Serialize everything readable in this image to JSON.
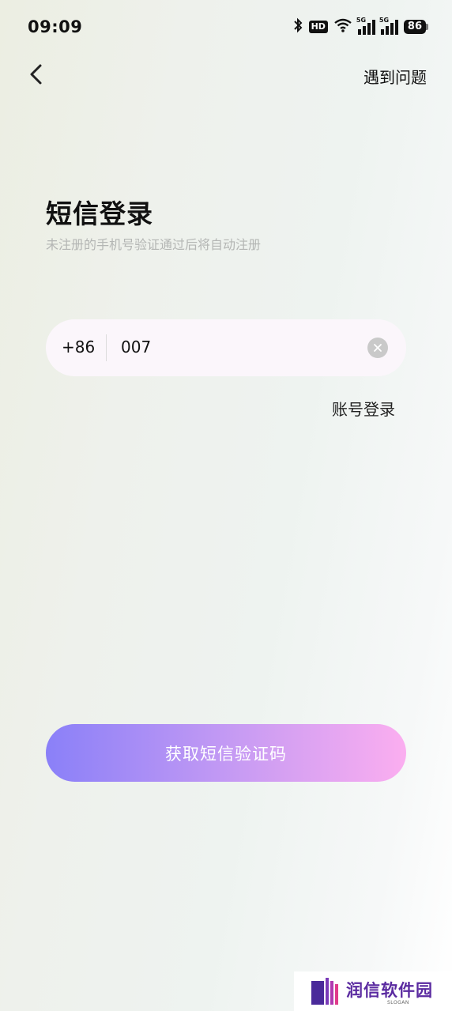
{
  "status_bar": {
    "time": "09:09",
    "hd_label": "HD",
    "sim1_gen": "5G",
    "sim2_gen": "5G",
    "battery": "86",
    "icons": [
      "bluetooth-icon",
      "hd-icon",
      "wifi-icon",
      "signal-5g-icon",
      "signal-5g-icon",
      "battery-icon"
    ]
  },
  "header": {
    "back_icon": "chevron-left-icon",
    "help_label": "遇到问题"
  },
  "login": {
    "title": "短信登录",
    "subtitle": "未注册的手机号验证通过后将自动注册",
    "country_code": "+86",
    "phone_value": "007",
    "clear_icon": "clear-icon",
    "account_login_label": "账号登录",
    "submit_label": "获取短信验证码"
  },
  "watermark": {
    "text": "润信软件园",
    "slogan": "SLOGAN"
  },
  "colors": {
    "button_gradient_start": "#8a80f8",
    "button_gradient_end": "#fbaef0",
    "input_background": "#fbf6fb",
    "subtitle_gray": "#b4b6b4"
  }
}
